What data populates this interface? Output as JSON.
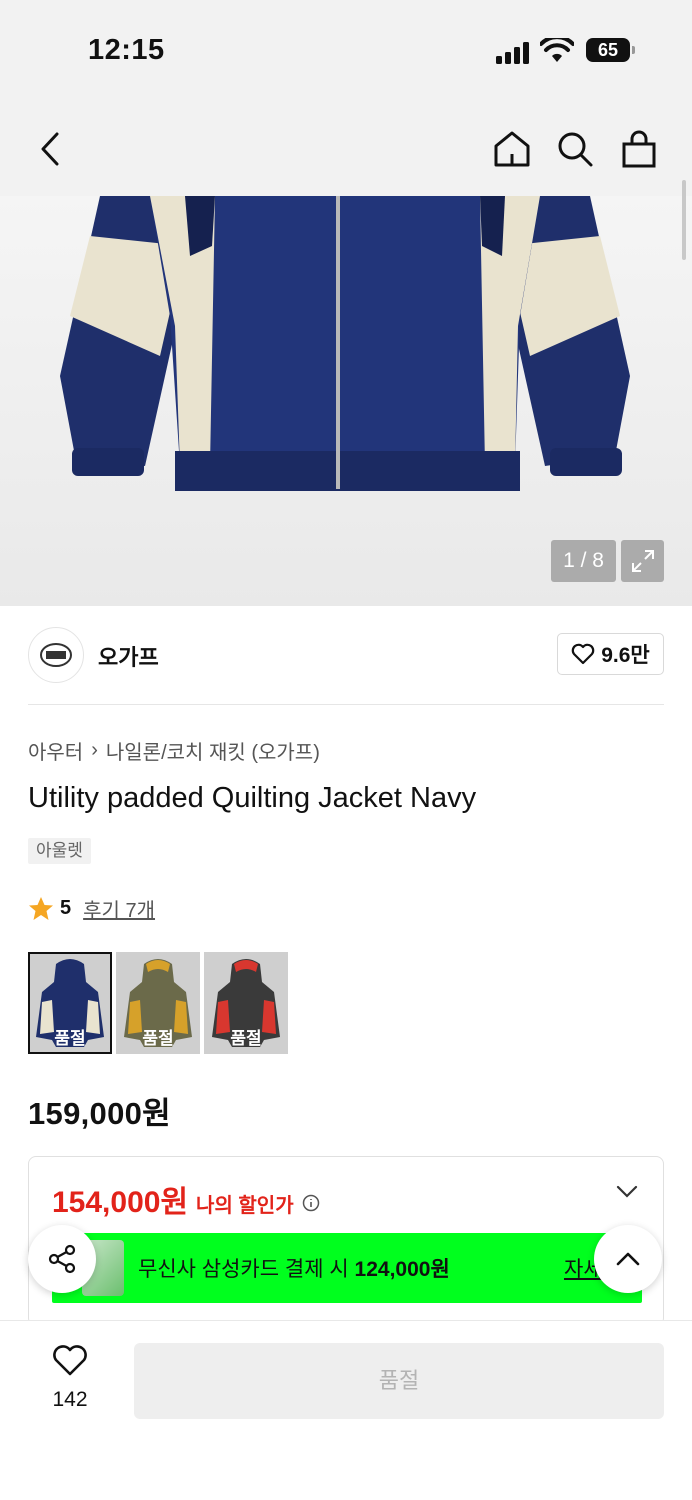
{
  "status_bar": {
    "time": "12:15",
    "battery": "65"
  },
  "gallery": {
    "counter": "1 / 8"
  },
  "brand": {
    "name": "오가프",
    "likes": "9.6만"
  },
  "breadcrumb": {
    "category": "아우터",
    "separator": "›",
    "subcategory": "나일론/코치 재킷 (오가프)"
  },
  "product": {
    "title": "Utility padded Quilting Jacket Navy",
    "tag": "아울렛",
    "rating": "5",
    "review_link": "후기 7개",
    "price": "159,000원"
  },
  "variants": [
    {
      "label": "품절",
      "colors": [
        "#1f2f6b",
        "#e9e3cf"
      ]
    },
    {
      "label": "품절",
      "colors": [
        "#6b6a4a",
        "#d6a12a"
      ]
    },
    {
      "label": "품절",
      "colors": [
        "#3a3a3a",
        "#d8372f"
      ]
    }
  ],
  "discount": {
    "my_price": "154,000원",
    "my_price_label": "나의 할인가",
    "promo_text": "무신사 삼성카드 결제 시",
    "promo_price": "124,000원",
    "promo_more": "자세히"
  },
  "bottom_bar": {
    "wish_count": "142",
    "buy_label": "품절"
  },
  "colors": {
    "accent_red": "#e2231a",
    "promo_green": "#00ff1e",
    "star": "#f5a623"
  }
}
